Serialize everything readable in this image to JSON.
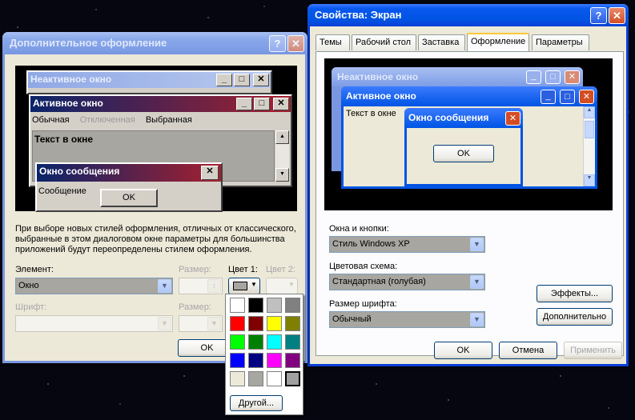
{
  "adv_dialog": {
    "title": "Дополнительное оформление",
    "preview": {
      "inactive_title": "Неактивное окно",
      "active_title": "Активное окно",
      "menu": [
        "Обычная",
        "Отключенная",
        "Выбранная"
      ],
      "window_text": "Текст в окне",
      "msgbox_title": "Окно сообщения",
      "msgbox_text": "Сообщение",
      "ok_label": "OK"
    },
    "description": "При выборе новых стилей оформления, отличных от классического, выбранные в этом диалоговом окне параметры для большинства приложений будут переопределены стилем оформления.",
    "element_label": "Элемент:",
    "element_value": "Окно",
    "size_label": "Размер:",
    "color1_label": "Цвет 1:",
    "color2_label": "Цвет 2:",
    "font_label": "Шрифт:",
    "font_size_label": "Размер:",
    "ok_label": "OK",
    "palette": {
      "colors": [
        "#ffffff",
        "#000000",
        "#c0c0c0",
        "#808080",
        "#ff0000",
        "#800000",
        "#ffff00",
        "#808000",
        "#00ff00",
        "#008000",
        "#00ffff",
        "#008080",
        "#0000ff",
        "#000080",
        "#ff00ff",
        "#800080",
        "#ece9d8",
        "#a7a6a0",
        "#ffffff",
        "#a0a0a0"
      ],
      "other_label": "Другой..."
    }
  },
  "display_props": {
    "title": "Свойства: Экран",
    "tabs": [
      "Темы",
      "Рабочий стол",
      "Заставка",
      "Оформление",
      "Параметры"
    ],
    "active_tab": "Оформление",
    "preview": {
      "inactive_title": "Неактивное окно",
      "active_title": "Активное окно",
      "window_text": "Текст в окне",
      "msgbox_title": "Окно сообщения",
      "ok_label": "OK"
    },
    "windows_buttons_label": "Окна и кнопки:",
    "windows_buttons_value": "Стиль Windows XP",
    "color_scheme_label": "Цветовая схема:",
    "color_scheme_value": "Стандартная (голубая)",
    "font_size_label": "Размер шрифта:",
    "font_size_value": "Обычный",
    "effects_label": "Эффекты...",
    "advanced_label": "Дополнительно",
    "ok_label": "OK",
    "cancel_label": "Отмена",
    "apply_label": "Применить"
  },
  "colors": {
    "xp_blue": "#0054e3",
    "inactive_blue": "#7a96df",
    "classic_active_from": "#0a246a",
    "classic_active_to": "#a6202e"
  }
}
